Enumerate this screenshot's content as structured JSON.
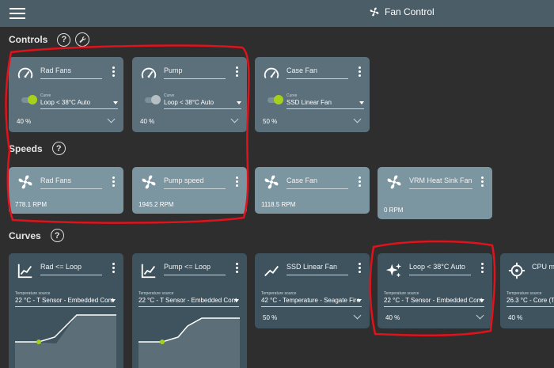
{
  "app": {
    "title": "Fan Control"
  },
  "sections": {
    "controls": "Controls",
    "speeds": "Speeds",
    "curves": "Curves",
    "help": "?"
  },
  "controls": [
    {
      "name": "Rad Fans",
      "curve_label": "Curve",
      "curve_value": "Loop < 38°C Auto",
      "percent": "40 %"
    },
    {
      "name": "Pump",
      "curve_label": "Curve",
      "curve_value": "Loop < 38°C Auto",
      "percent": "40 %"
    },
    {
      "name": "Case Fan",
      "curve_label": "Curve",
      "curve_value": "SSD Linear Fan",
      "percent": "50 %"
    }
  ],
  "speeds": [
    {
      "name": "Rad Fans",
      "rpm": "778.1 RPM"
    },
    {
      "name": "Pump speed",
      "rpm": "1945.2 RPM"
    },
    {
      "name": "Case Fan",
      "rpm": "1118.5 RPM"
    },
    {
      "name": "VRM Heat Sink Fan",
      "rpm": "0 RPM"
    }
  ],
  "curves": [
    {
      "name": "Rad <= Loop",
      "source_label": "Temperature source",
      "source": "22 °C - T Sensor - Embedded Cont"
    },
    {
      "name": "Pump <= Loop",
      "source_label": "Temperature source",
      "source": "22 °C - T Sensor - Embedded Cont"
    },
    {
      "name": "SSD Linear Fan",
      "source_label": "Temperature source",
      "source": "42 °C - Temperature - Seagate Fire",
      "percent": "50 %"
    },
    {
      "name": "Loop < 38°C Auto",
      "source_label": "Temperature source",
      "source": "22 °C - T Sensor - Embedded Cont",
      "percent": "40 %"
    },
    {
      "name": "CPU m",
      "source_label": "Temperature source",
      "source": "26.3 °C - Core (Tc",
      "percent": "40 %"
    }
  ],
  "colors": {
    "topbar": "#4b5d66",
    "toggle_on": "#a5d11c",
    "annotation": "#e0121b"
  }
}
